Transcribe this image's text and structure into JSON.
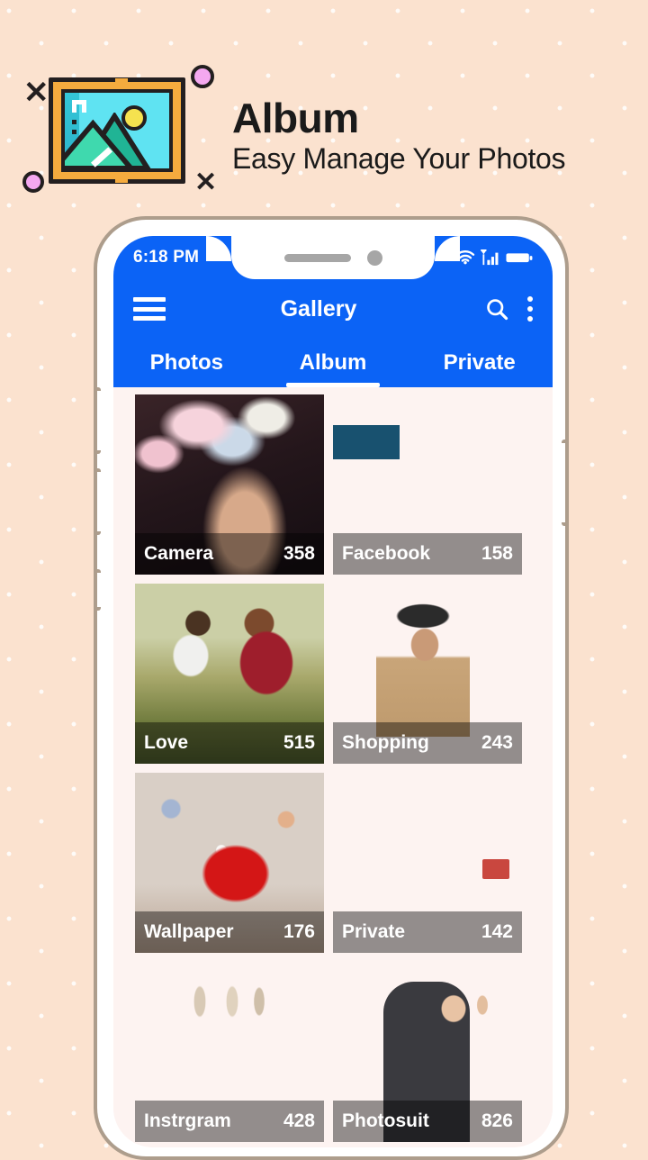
{
  "brand": {
    "title": "Album",
    "subtitle": "Easy Manage Your Photos",
    "logo_icon": "picture-frame-icon",
    "decorations": [
      "x-mark",
      "x-mark",
      "circle",
      "circle"
    ],
    "bg_color": "#FBE2CF"
  },
  "phone": {
    "status_bar": {
      "time": "6:18 PM",
      "icons": [
        "wifi-icon",
        "signal-icon",
        "battery-icon"
      ]
    },
    "app_bar": {
      "menu_icon": "hamburger-menu-icon",
      "title": "Gallery",
      "search_icon": "search-icon",
      "overflow_icon": "kebab-menu-icon",
      "accent_color": "#0B63F6"
    },
    "tabs": [
      {
        "label": "Photos",
        "active": false
      },
      {
        "label": "Album",
        "active": true
      },
      {
        "label": "Private",
        "active": false
      }
    ],
    "albums": [
      {
        "name": "Camera",
        "count": "358",
        "art": "ph-camera"
      },
      {
        "name": "Facebook",
        "count": "158",
        "art": "ph-facebook"
      },
      {
        "name": "Love",
        "count": "515",
        "art": "ph-love"
      },
      {
        "name": "Shopping",
        "count": "243",
        "art": "ph-shopping"
      },
      {
        "name": "Wallpaper",
        "count": "176",
        "art": "ph-wallpaper"
      },
      {
        "name": "Private",
        "count": "142",
        "art": "ph-private"
      },
      {
        "name": "Instrgram",
        "count": "428",
        "art": "ph-instrgram"
      },
      {
        "name": "Photosuit",
        "count": "826",
        "art": "ph-photosuit"
      }
    ]
  }
}
